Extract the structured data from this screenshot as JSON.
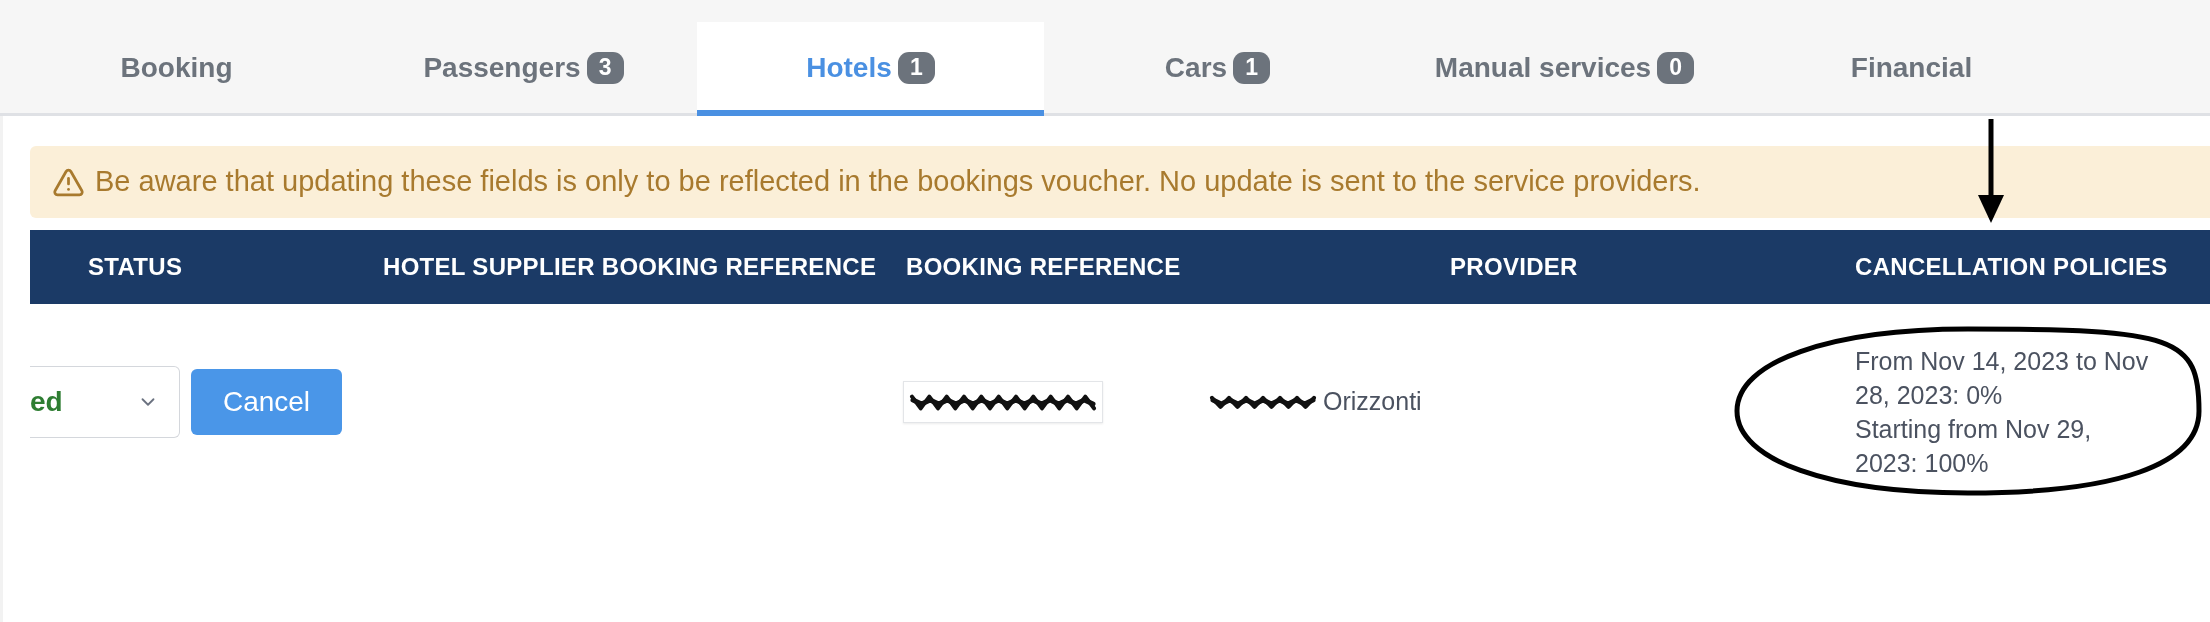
{
  "tabs": [
    {
      "label": "Booking",
      "selected": false
    },
    {
      "label": "Passengers",
      "count": "3",
      "selected": false
    },
    {
      "label": "Hotels",
      "count": "1",
      "selected": true
    },
    {
      "label": "Cars",
      "count": "1",
      "selected": false
    },
    {
      "label": "Manual services",
      "count": "0",
      "selected": false
    },
    {
      "label": "Financial",
      "selected": false
    }
  ],
  "notice": {
    "kind": "warning",
    "text": "Be aware that updating these fields is only to be reflected in the bookings voucher. No update is sent to the service providers."
  },
  "table": {
    "columns": [
      {
        "label": "STATUS",
        "arrow": false
      },
      {
        "label": "HOTEL SUPPLIER BOOKING REFERENCE",
        "arrow": false
      },
      {
        "label": "BOOKING REFERENCE",
        "arrow": false
      },
      {
        "label": "PROVIDER",
        "arrow": false
      },
      {
        "label": "CANCELLATION POLICIES",
        "arrow": true
      }
    ],
    "rows": [
      {
        "status": {
          "value": "ed"
        },
        "action": "Cancel",
        "booking_reference": {
          "redacted": true
        },
        "provider": {
          "text": "Orizzonti",
          "redacted": true
        },
        "cancellation_policies": {
          "circled": true,
          "items": [
            "From Nov 14, 2023 to Nov 28, 2023: 0%",
            "Starting from Nov 29, 2023: 100%"
          ]
        }
      }
    ]
  }
}
